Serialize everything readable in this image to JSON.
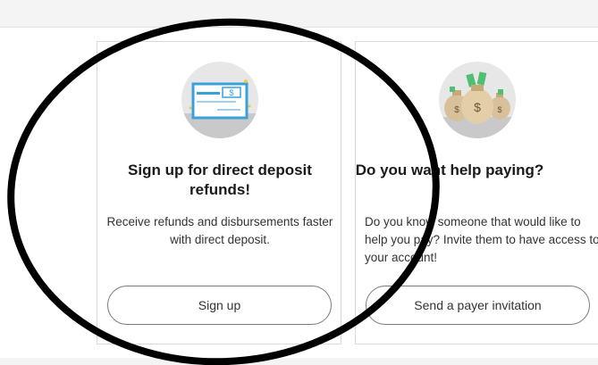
{
  "cards": [
    {
      "title": "Sign up for direct deposit refunds!",
      "description": "Receive refunds and disbursements faster with direct deposit.",
      "button_label": "Sign up",
      "icon": "check-icon"
    },
    {
      "title": "Do you want help paying?",
      "description": "Do you know someone that would like to help you pay? Invite them to have access to your account!",
      "button_label": "Send a payer invitation",
      "icon": "money-bags-icon"
    }
  ],
  "colors": {
    "page_background": "#f4f4f4",
    "card_background": "#ffffff",
    "card_border": "#d9d9d9",
    "icon_circle": "#e7e7e8",
    "check_blue": "#3aa0d8",
    "money_green": "#4fbf73",
    "bag_tan": "#d8c19a",
    "annotation_stroke": "#000000"
  }
}
